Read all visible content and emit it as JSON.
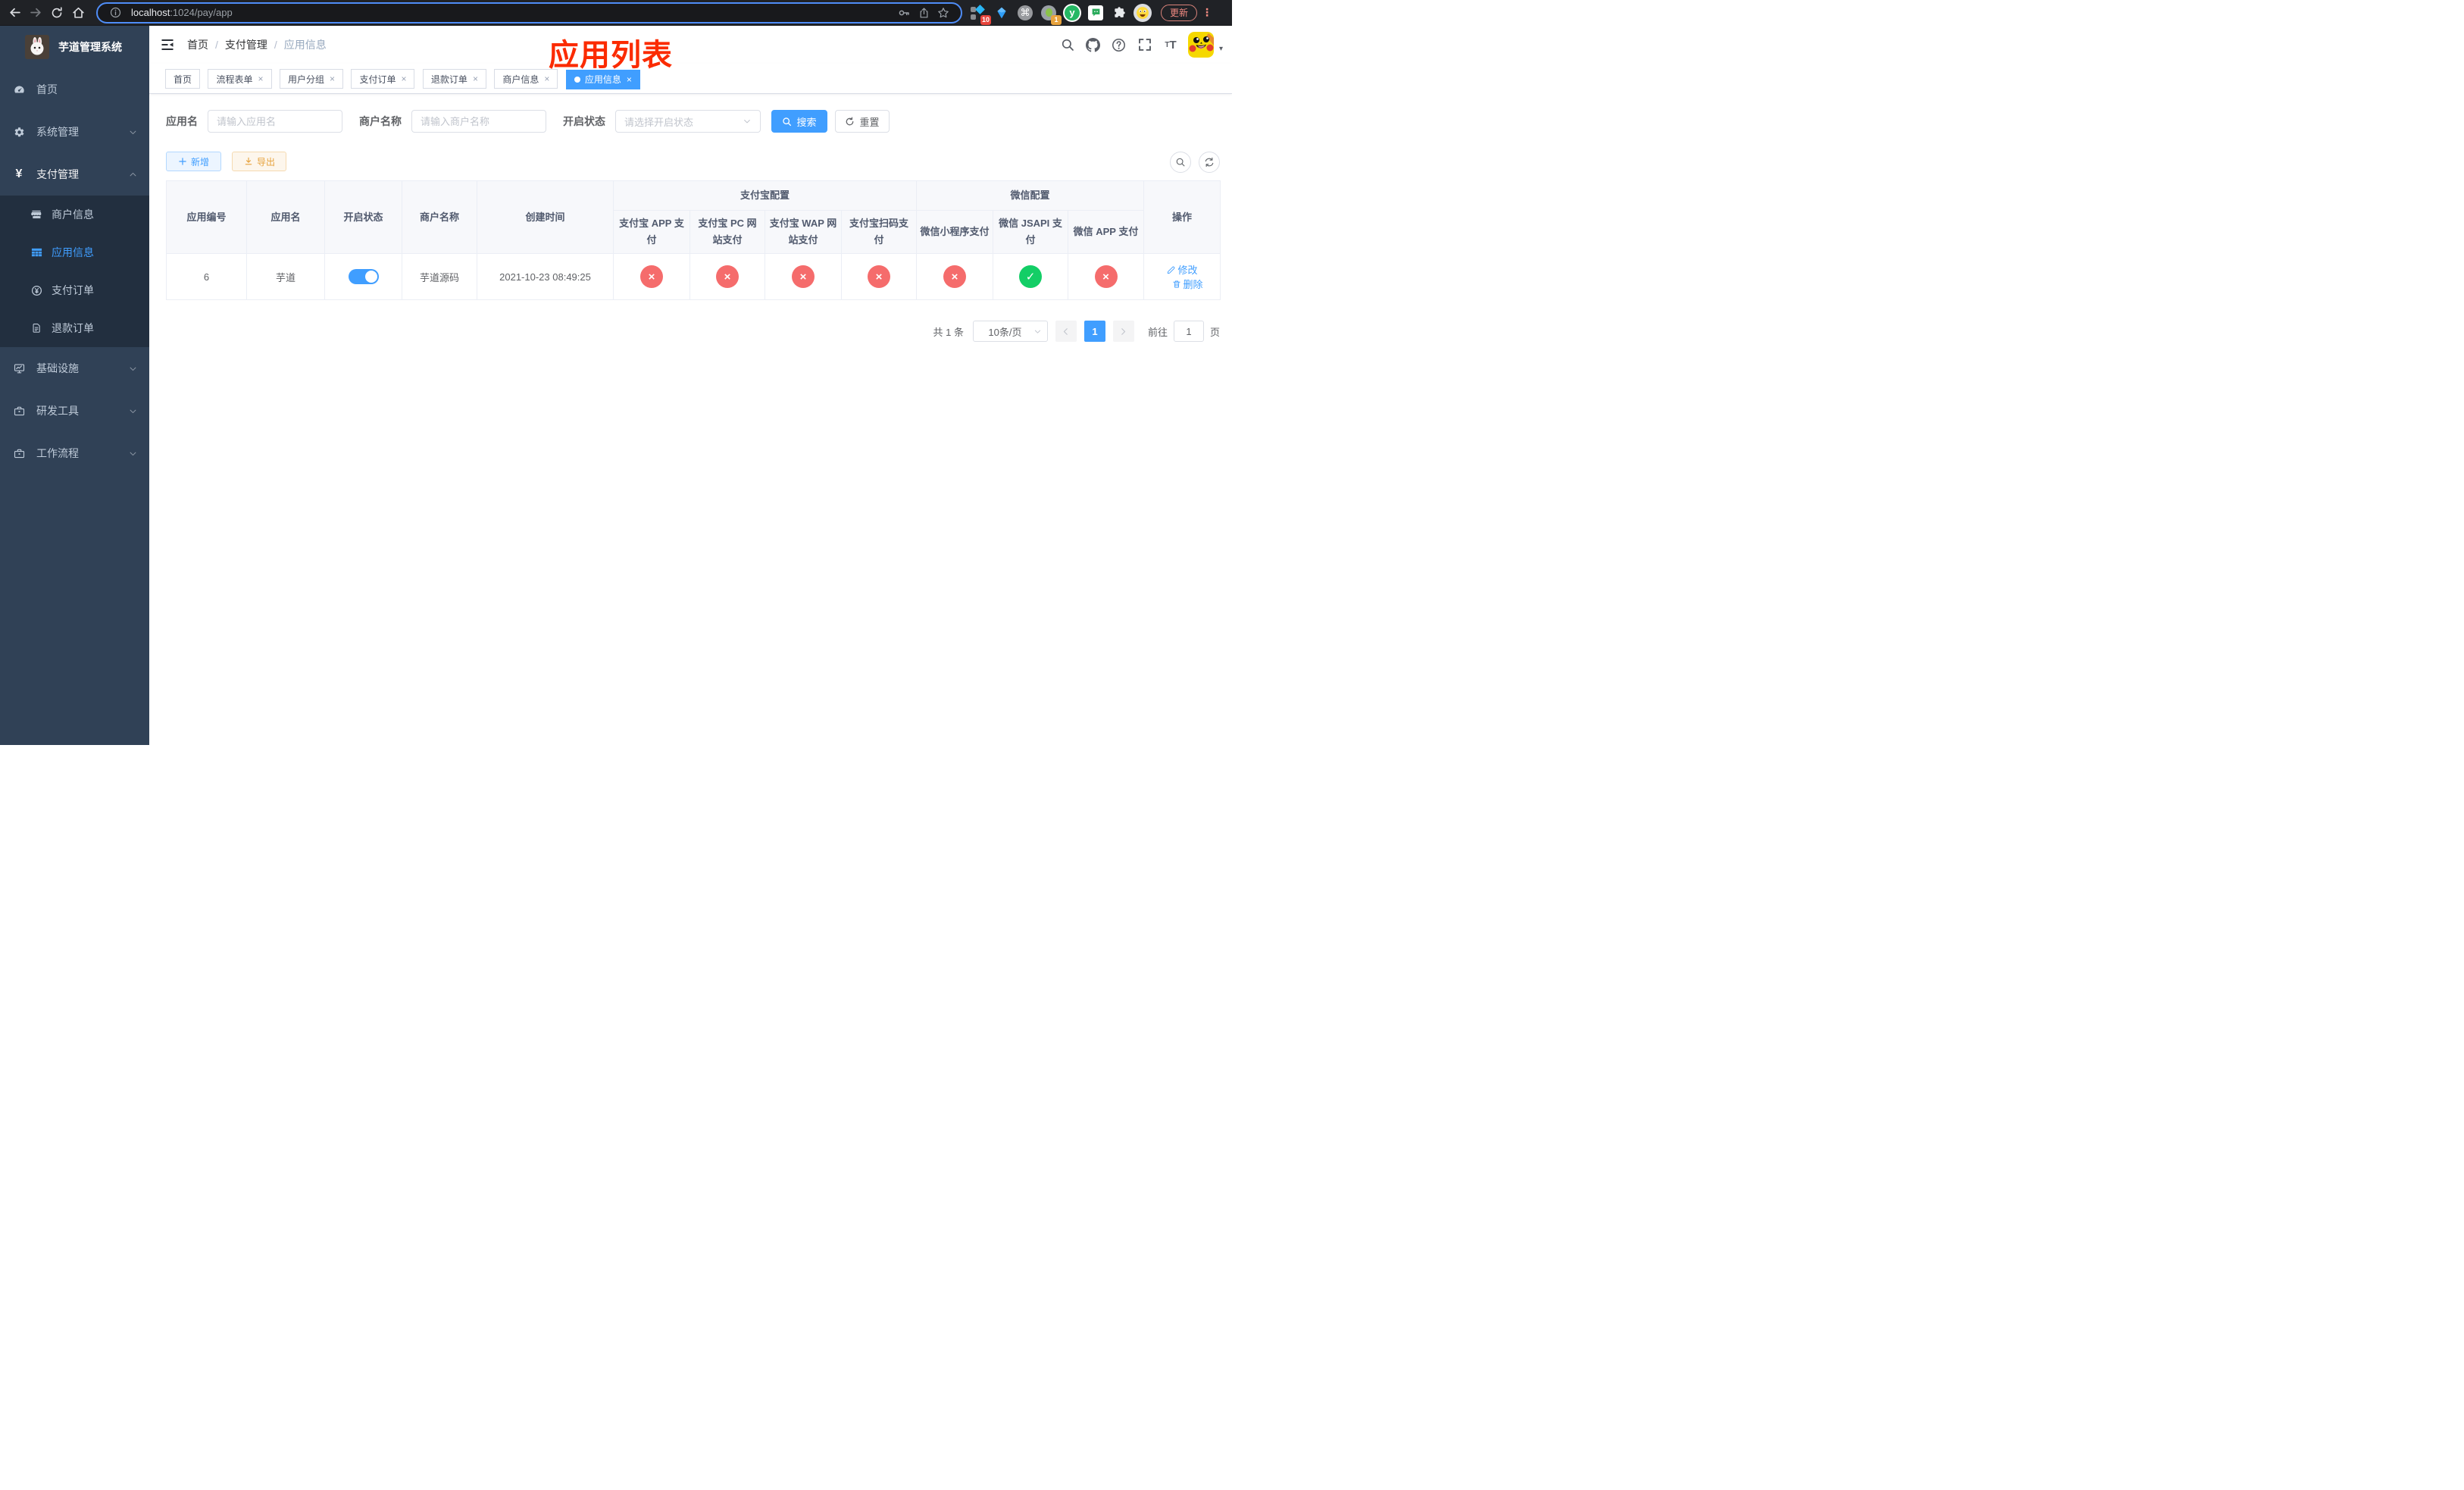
{
  "browser": {
    "url": {
      "host": "localhost",
      "path": ":1024/pay/app"
    },
    "update_label": "更新",
    "ext_badge_tabs": "10",
    "ext_badge_notify": "1",
    "ext_y_logo": "y",
    "command_glyph": "⌘",
    "kebab_glyph": "⋮"
  },
  "ui": {
    "close_glyph": "×",
    "check_glyph": "✓",
    "cross_glyph": "×",
    "breadcrumb_sep": "/",
    "caret_glyph": "▾"
  },
  "sidebar": {
    "title": "芋道管理系统",
    "menu": [
      {
        "label": "首页"
      },
      {
        "label": "系统管理"
      },
      {
        "label": "支付管理"
      },
      {
        "label": "商户信息"
      },
      {
        "label": "应用信息"
      },
      {
        "label": "支付订单"
      },
      {
        "label": "退款订单"
      },
      {
        "label": "基础设施"
      },
      {
        "label": "研发工具"
      },
      {
        "label": "工作流程"
      }
    ],
    "yen_glyph": "¥"
  },
  "header": {
    "breadcrumb": [
      "首页",
      "支付管理",
      "应用信息"
    ],
    "overlay_title": "应用列表"
  },
  "tabs": [
    {
      "label": "首页"
    },
    {
      "label": "流程表单"
    },
    {
      "label": "用户分组"
    },
    {
      "label": "支付订单"
    },
    {
      "label": "退款订单"
    },
    {
      "label": "商户信息"
    },
    {
      "label": "应用信息"
    }
  ],
  "filters": {
    "app_name_label": "应用名",
    "app_name_placeholder": "请输入应用名",
    "merchant_label": "商户名称",
    "merchant_placeholder": "请输入商户名称",
    "status_label": "开启状态",
    "status_placeholder": "请选择开启状态",
    "search_label": "搜索",
    "reset_label": "重置"
  },
  "toolbar": {
    "add_label": "新增",
    "export_label": "导出"
  },
  "table": {
    "headers": {
      "app_id": "应用编号",
      "app_name": "应用名",
      "open_status": "开启状态",
      "merchant_name": "商户名称",
      "create_time": "创建时间",
      "alipay_group": "支付宝配置",
      "wechat_group": "微信配置",
      "actions": "操作",
      "alipay_app": "支付宝 APP 支付",
      "alipay_pc": "支付宝 PC 网站支付",
      "alipay_wap": "支付宝 WAP 网站支付",
      "alipay_qr": "支付宝扫码支付",
      "wx_mini": "微信小程序支付",
      "wx_jsapi": "微信 JSAPI 支付",
      "wx_app": "微信 APP 支付"
    },
    "rows": [
      {
        "app_id": "6",
        "app_name": "芋道",
        "open_status": "on",
        "merchant_name": "芋道源码",
        "create_time": "2021-10-23 08:49:25",
        "alipay_app": "disabled",
        "alipay_pc": "disabled",
        "alipay_wap": "disabled",
        "alipay_qr": "disabled",
        "wx_mini": "disabled",
        "wx_jsapi": "enabled",
        "wx_app": "disabled",
        "edit_label": "修改",
        "delete_label": "删除"
      }
    ]
  },
  "pagination": {
    "total_text": "共 1 条",
    "page_size": "10条/页",
    "current_page": "1",
    "goto_label": "前往",
    "goto_value": "1",
    "page_unit": "页"
  },
  "colors": {
    "accent": "#409eff",
    "danger": "#f56c6c",
    "success": "#13ce66",
    "warning": "#e6a23c",
    "annotation_red": "#fb2b00"
  }
}
